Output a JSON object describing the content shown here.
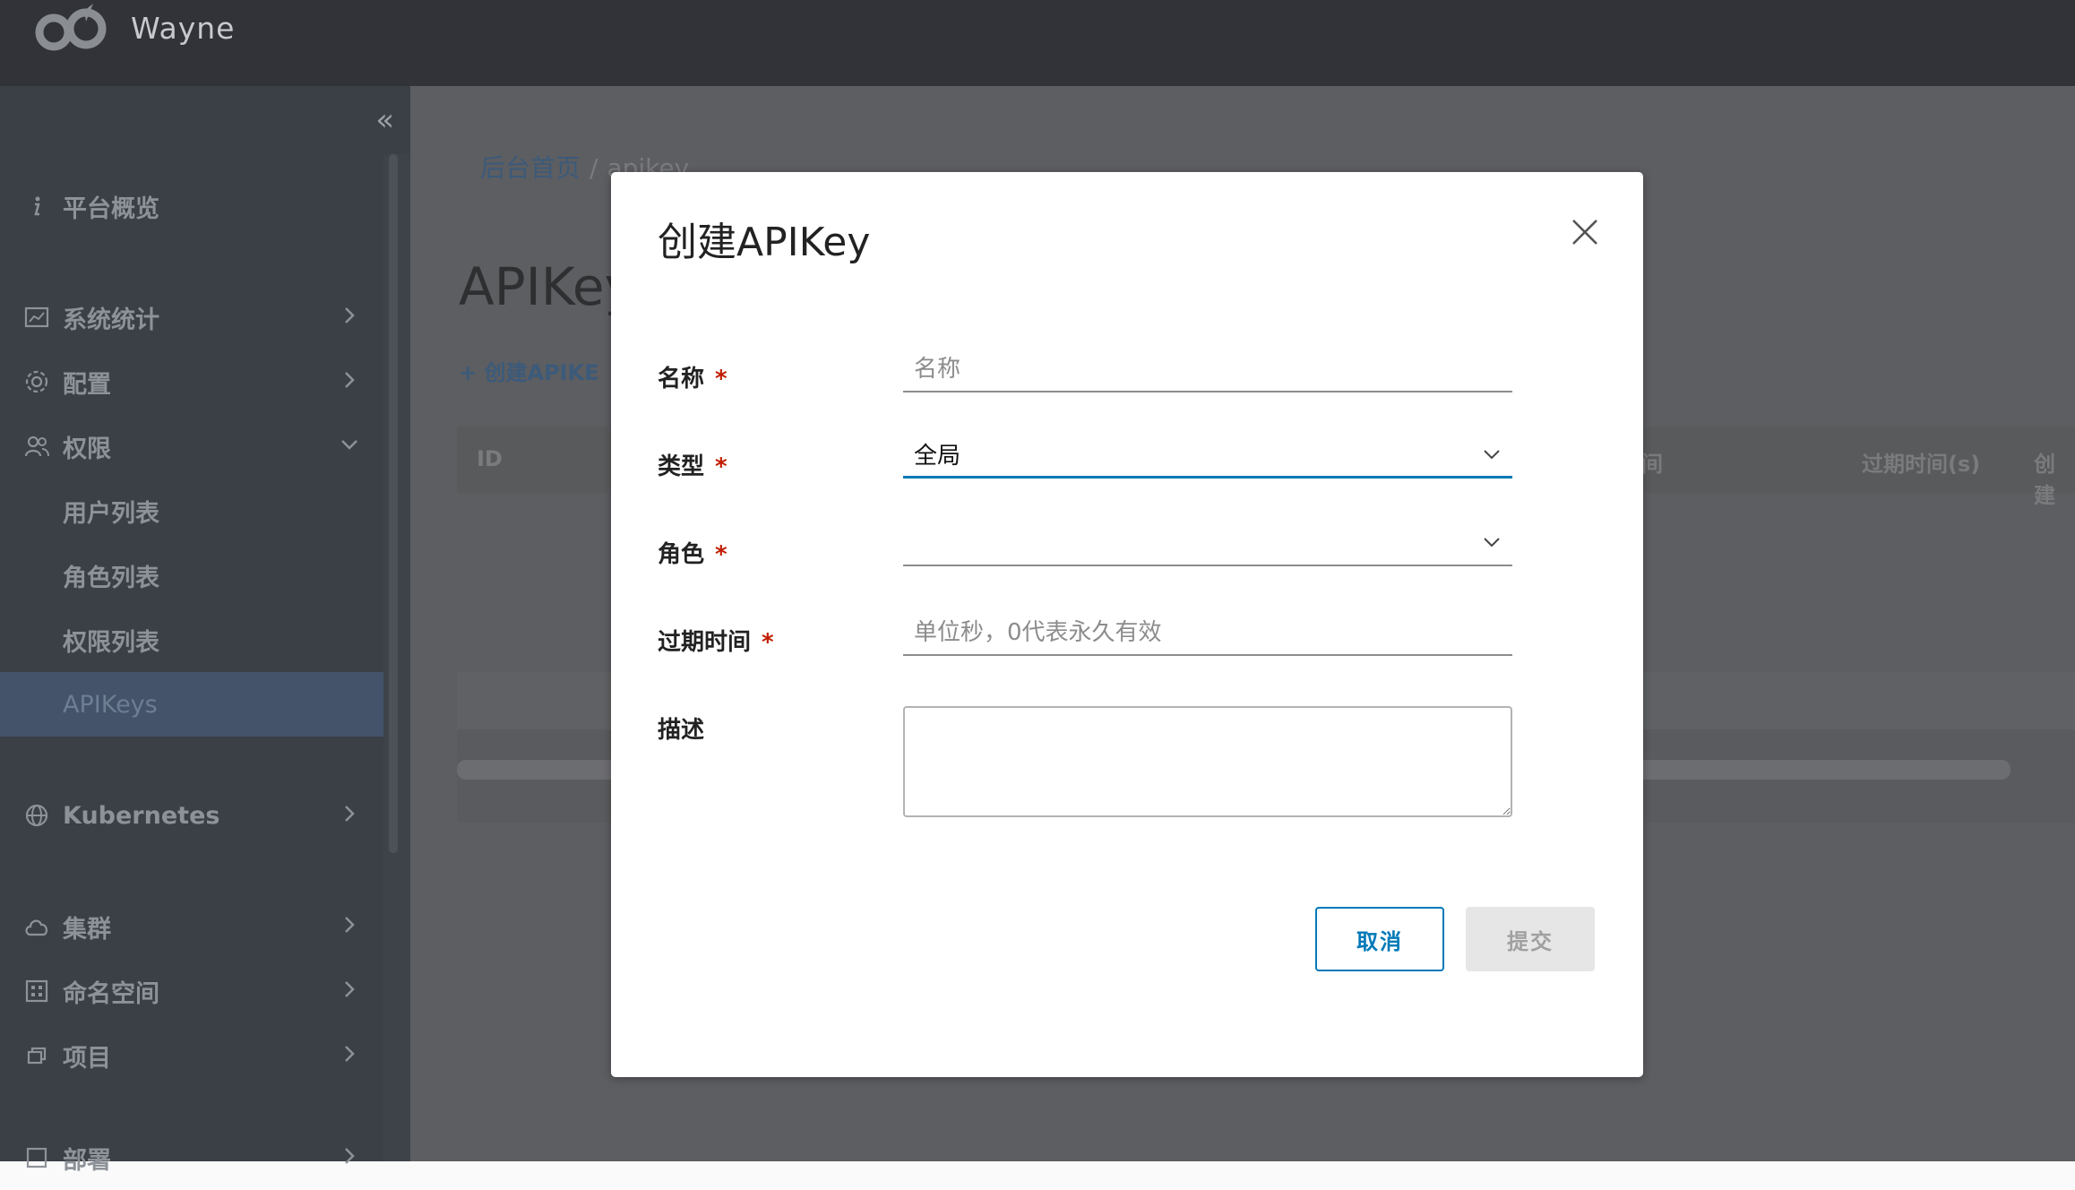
{
  "app": {
    "brand": "Wayne"
  },
  "sidebar": {
    "collapse_glyph": "«",
    "items": [
      {
        "label": "平台概览",
        "icon": "info-icon"
      },
      {
        "label": "系统统计",
        "icon": "chart-icon"
      },
      {
        "label": "配置",
        "icon": "gear-icon"
      },
      {
        "label": "权限",
        "icon": "users-icon"
      },
      {
        "label": "用户列表"
      },
      {
        "label": "角色列表"
      },
      {
        "label": "权限列表"
      },
      {
        "label": "APIKeys"
      },
      {
        "label": "Kubernetes",
        "icon": "globe-icon"
      },
      {
        "label": "集群",
        "icon": "cloud-icon"
      },
      {
        "label": "命名空间",
        "icon": "grid-icon"
      },
      {
        "label": "项目",
        "icon": "copy-icon"
      },
      {
        "label": "部署",
        "icon": "deploy-icon"
      }
    ]
  },
  "main": {
    "breadcrumb": {
      "home": "后台首页",
      "separator": "/",
      "current": "apikey"
    },
    "page_title": "APIKey",
    "create_link": "+ 创建APIKE",
    "table": {
      "headers": [
        "ID",
        "间",
        "过期时间(s)",
        "创建"
      ]
    }
  },
  "modal": {
    "title": "创建APIKey",
    "fields": {
      "name": {
        "label": "名称",
        "required": "*",
        "placeholder": "名称",
        "value": ""
      },
      "type": {
        "label": "类型",
        "required": "*",
        "value": "全局"
      },
      "role": {
        "label": "角色",
        "required": "*",
        "value": ""
      },
      "expire": {
        "label": "过期时间",
        "required": "*",
        "placeholder": "单位秒，0代表永久有效",
        "value": ""
      },
      "description": {
        "label": "描述",
        "value": ""
      }
    },
    "buttons": {
      "cancel": "取消",
      "submit": "提交"
    }
  },
  "colors": {
    "accent": "#0079b8",
    "required": "#c21d00",
    "header_bg": "#313338",
    "sidebar_bg": "#3b3f46",
    "active_item_bg": "#44536a"
  }
}
